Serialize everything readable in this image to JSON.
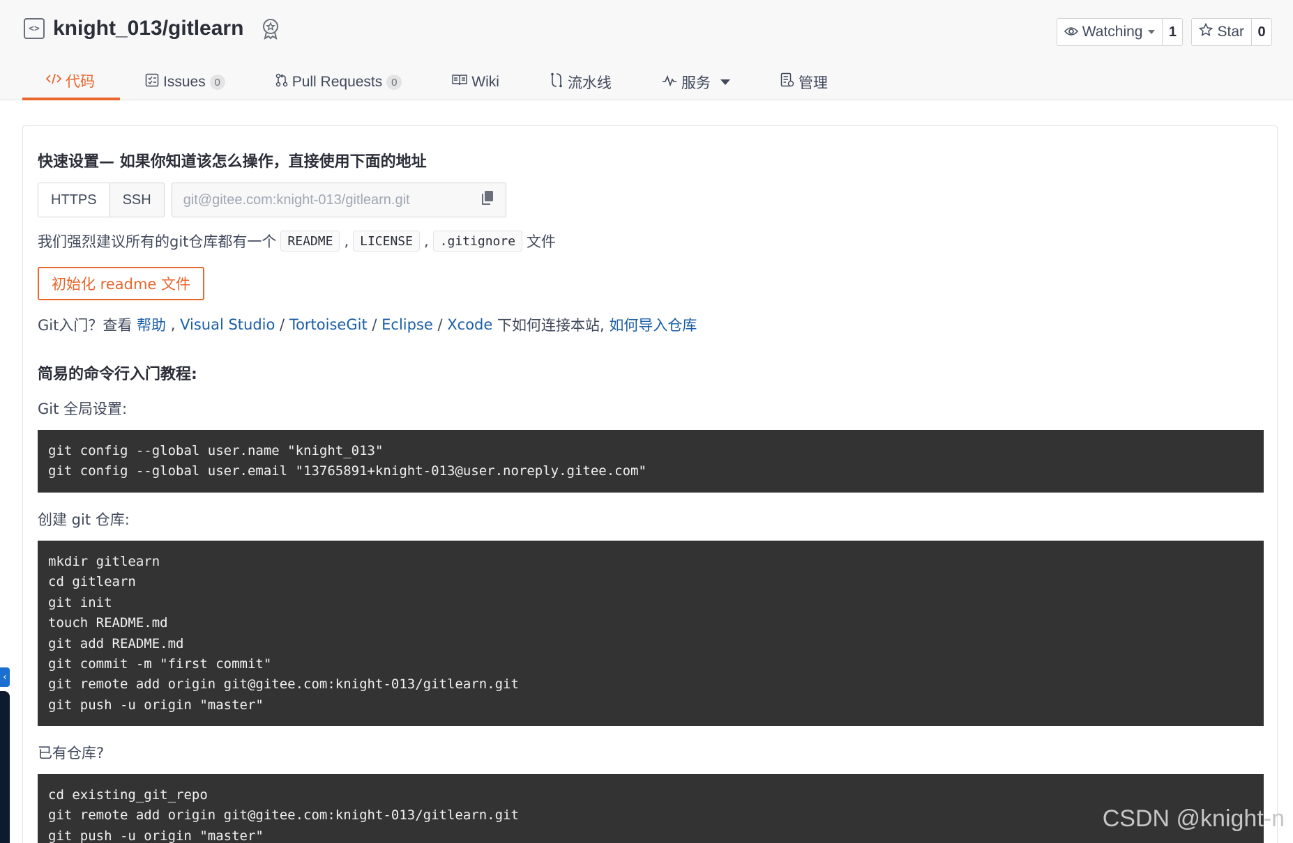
{
  "repo": {
    "icon": "repo-code-icon",
    "name": "knight_013/gitlearn",
    "badge_icon": "award-badge-icon"
  },
  "actions": {
    "watch": {
      "label": "Watching",
      "count": "1",
      "icon": "eye-icon"
    },
    "star": {
      "label": "Star",
      "count": "0",
      "icon": "star-icon"
    }
  },
  "tabs": [
    {
      "label": "代码",
      "icon": "code-icon",
      "active": true
    },
    {
      "label": "Issues",
      "count": "0",
      "icon": "issues-icon"
    },
    {
      "label": "Pull Requests",
      "count": "0",
      "icon": "pull-request-icon"
    },
    {
      "label": "Wiki",
      "icon": "book-icon"
    },
    {
      "label": "流水线",
      "icon": "pipeline-icon"
    },
    {
      "label": "服务",
      "icon": "activity-icon",
      "has_dropdown": true
    },
    {
      "label": "管理",
      "icon": "settings-doc-icon"
    }
  ],
  "quick_setup": {
    "title": "快速设置— 如果你知道该怎么操作，直接使用下面的地址",
    "protocols": [
      "HTTPS",
      "SSH"
    ],
    "url": "git@gitee.com:knight-013/gitlearn.git",
    "copy_icon": "copy-icon",
    "recommend_prefix": "我们强烈建议所有的git仓库都有一个",
    "recommend_files": [
      "README",
      "LICENSE",
      ".gitignore"
    ],
    "recommend_sep": ",",
    "recommend_suffix": "文件",
    "init_button": "初始化 readme 文件"
  },
  "help_line": {
    "prefix": "Git入门？查看",
    "help": "帮助",
    "sep1": ",",
    "visual_studio": "Visual Studio",
    "slash": "/",
    "tortoisegit": "TortoiseGit",
    "eclipse": "Eclipse",
    "xcode": "Xcode",
    "middle": "下如何连接本站,",
    "import": "如何导入仓库"
  },
  "tutorial": {
    "title": "简易的命令行入门教程:",
    "global_label": "Git 全局设置:",
    "global_code": "git config --global user.name \"knight_013\"\ngit config --global user.email \"13765891+knight-013@user.noreply.gitee.com\"",
    "create_label": "创建 git 仓库:",
    "create_code": "mkdir gitlearn\ncd gitlearn\ngit init\ntouch README.md\ngit add README.md\ngit commit -m \"first commit\"\ngit remote add origin git@gitee.com:knight-013/gitlearn.git\ngit push -u origin \"master\"",
    "existing_label": "已有仓库?",
    "existing_code": "cd existing_git_repo\ngit remote add origin git@gitee.com:knight-013/gitlearn.git\ngit push -u origin \"master\""
  },
  "watermark": "CSDN @knight-n",
  "colors": {
    "accent": "#e9662c",
    "link": "#1b5fa8",
    "code_bg": "#333333"
  }
}
